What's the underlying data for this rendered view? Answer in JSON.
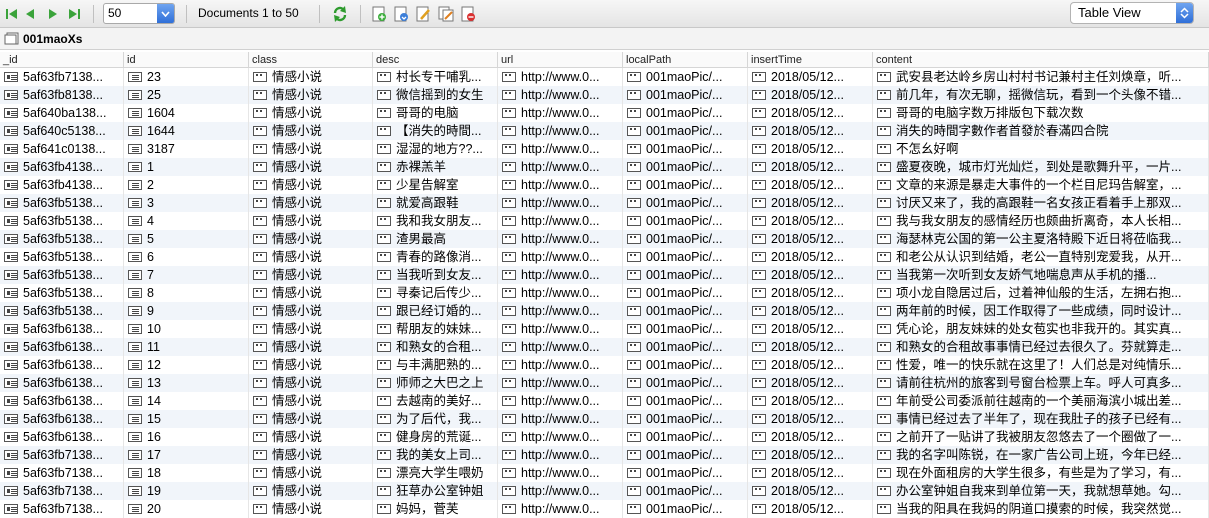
{
  "toolbar": {
    "page_size": "50",
    "doc_info": "Documents 1 to 50",
    "view_mode": "Table View"
  },
  "collection": {
    "name": "001maoXs"
  },
  "columns": [
    "_id",
    "id",
    "class",
    "desc",
    "url",
    "localPath",
    "insertTime",
    "content"
  ],
  "rows": [
    {
      "_id": "5af63fb7138...",
      "id": "23",
      "class": "情感小说",
      "desc": "村长专干哺乳...",
      "url": "http://www.0...",
      "localPath": "001maoPic/...",
      "insertTime": "2018/05/12...",
      "content": "武安县老达岭乡房山村村书记兼村主任刘焕章，听..."
    },
    {
      "_id": "5af63fb8138...",
      "id": "25",
      "class": "情感小说",
      "desc": "微信摇到的女生",
      "url": "http://www.0...",
      "localPath": "001maoPic/...",
      "insertTime": "2018/05/12...",
      "content": "前几年，有次无聊，摇微信玩，看到一个头像不错..."
    },
    {
      "_id": "5af640ba138...",
      "id": "1604",
      "class": "情感小说",
      "desc": "哥哥的电脑",
      "url": "http://www.0...",
      "localPath": "001maoPic/...",
      "insertTime": "2018/05/12...",
      "content": "哥哥的电脑字数万排版包下载次数"
    },
    {
      "_id": "5af640c5138...",
      "id": "1644",
      "class": "情感小说",
      "desc": "【消失的時間...",
      "url": "http://www.0...",
      "localPath": "001maoPic/...",
      "insertTime": "2018/05/12...",
      "content": "消失的時間字數作者首發於春滿四合院"
    },
    {
      "_id": "5af641c0138...",
      "id": "3187",
      "class": "情感小说",
      "desc": "湿湿的地方??...",
      "url": "http://www.0...",
      "localPath": "001maoPic/...",
      "insertTime": "2018/05/12...",
      "content": "不怎幺好啊"
    },
    {
      "_id": "5af63fb4138...",
      "id": "1",
      "class": "情感小说",
      "desc": "赤裸羔羊",
      "url": "http://www.0...",
      "localPath": "001maoPic/...",
      "insertTime": "2018/05/12...",
      "content": "盛夏夜晚，城市灯光灿烂，到处是歌舞升平，一片..."
    },
    {
      "_id": "5af63fb4138...",
      "id": "2",
      "class": "情感小说",
      "desc": "少星告解室",
      "url": "http://www.0...",
      "localPath": "001maoPic/...",
      "insertTime": "2018/05/12...",
      "content": "文章的来源是暴走大事件的一个栏目尼玛告解室，..."
    },
    {
      "_id": "5af63fb5138...",
      "id": "3",
      "class": "情感小说",
      "desc": "就爱高跟鞋",
      "url": "http://www.0...",
      "localPath": "001maoPic/...",
      "insertTime": "2018/05/12...",
      "content": "讨厌又来了，我的高跟鞋一名女孩正看着手上那双..."
    },
    {
      "_id": "5af63fb5138...",
      "id": "4",
      "class": "情感小说",
      "desc": "我和我女朋友...",
      "url": "http://www.0...",
      "localPath": "001maoPic/...",
      "insertTime": "2018/05/12...",
      "content": "我与我女朋友的感情经历也颇曲折离奇，本人长相..."
    },
    {
      "_id": "5af63fb5138...",
      "id": "5",
      "class": "情感小说",
      "desc": "渣男最高",
      "url": "http://www.0...",
      "localPath": "001maoPic/...",
      "insertTime": "2018/05/12...",
      "content": "海瑟林克公国的第一公主夏洛特殿下近日将莅临我..."
    },
    {
      "_id": "5af63fb5138...",
      "id": "6",
      "class": "情感小说",
      "desc": "青春的路像消...",
      "url": "http://www.0...",
      "localPath": "001maoPic/...",
      "insertTime": "2018/05/12...",
      "content": "和老公从认识到结婚，老公一直特别宠爱我，从开..."
    },
    {
      "_id": "5af63fb5138...",
      "id": "7",
      "class": "情感小说",
      "desc": "当我听到女友...",
      "url": "http://www.0...",
      "localPath": "001maoPic/...",
      "insertTime": "2018/05/12...",
      "content": "当我第一次听到女友娇气地喘息声从手机的播..."
    },
    {
      "_id": "5af63fb5138...",
      "id": "8",
      "class": "情感小说",
      "desc": "寻秦记后传少...",
      "url": "http://www.0...",
      "localPath": "001maoPic/...",
      "insertTime": "2018/05/12...",
      "content": "项小龙自隐居过后，过着神仙般的生活，左拥右抱..."
    },
    {
      "_id": "5af63fb5138...",
      "id": "9",
      "class": "情感小说",
      "desc": "跟已经订婚的...",
      "url": "http://www.0...",
      "localPath": "001maoPic/...",
      "insertTime": "2018/05/12...",
      "content": "两年前的时候，因工作取得了一些成绩，同时设计..."
    },
    {
      "_id": "5af63fb6138...",
      "id": "10",
      "class": "情感小说",
      "desc": "帮朋友的妹妹...",
      "url": "http://www.0...",
      "localPath": "001maoPic/...",
      "insertTime": "2018/05/12...",
      "content": "凭心论，朋友妹妹的处女苞实也非我开的。其实真..."
    },
    {
      "_id": "5af63fb6138...",
      "id": "11",
      "class": "情感小说",
      "desc": "和熟女的合租...",
      "url": "http://www.0...",
      "localPath": "001maoPic/...",
      "insertTime": "2018/05/12...",
      "content": "和熟女的合租故事事情已经过去很久了。芬就算走..."
    },
    {
      "_id": "5af63fb6138...",
      "id": "12",
      "class": "情感小说",
      "desc": "与丰满肥熟的...",
      "url": "http://www.0...",
      "localPath": "001maoPic/...",
      "insertTime": "2018/05/12...",
      "content": "性爱，唯一的快乐就在这里了！人们总是对纯情乐..."
    },
    {
      "_id": "5af63fb6138...",
      "id": "13",
      "class": "情感小说",
      "desc": "师师之大巴之上",
      "url": "http://www.0...",
      "localPath": "001maoPic/...",
      "insertTime": "2018/05/12...",
      "content": "请前往杭州的旅客到号窗台检票上车。呼人可真多..."
    },
    {
      "_id": "5af63fb6138...",
      "id": "14",
      "class": "情感小说",
      "desc": "去越南的美好...",
      "url": "http://www.0...",
      "localPath": "001maoPic/...",
      "insertTime": "2018/05/12...",
      "content": "年前受公司委派前往越南的一个美丽海滨小城出差..."
    },
    {
      "_id": "5af63fb6138...",
      "id": "15",
      "class": "情感小说",
      "desc": "为了后代，我...",
      "url": "http://www.0...",
      "localPath": "001maoPic/...",
      "insertTime": "2018/05/12...",
      "content": "事情已经过去了半年了，现在我肚子的孩子已经有..."
    },
    {
      "_id": "5af63fb6138...",
      "id": "16",
      "class": "情感小说",
      "desc": "健身房的荒诞...",
      "url": "http://www.0...",
      "localPath": "001maoPic/...",
      "insertTime": "2018/05/12...",
      "content": "之前开了一贴讲了我被朋友忽悠去了一个圈做了一..."
    },
    {
      "_id": "5af63fb7138...",
      "id": "17",
      "class": "情感小说",
      "desc": "我的美女上司...",
      "url": "http://www.0...",
      "localPath": "001maoPic/...",
      "insertTime": "2018/05/12...",
      "content": "我的名字叫陈锐，在一家广告公司上班，今年已经..."
    },
    {
      "_id": "5af63fb7138...",
      "id": "18",
      "class": "情感小说",
      "desc": "漂亮大学生喂奶",
      "url": "http://www.0...",
      "localPath": "001maoPic/...",
      "insertTime": "2018/05/12...",
      "content": "现在外面租房的大学生很多，有些是为了学习，有..."
    },
    {
      "_id": "5af63fb7138...",
      "id": "19",
      "class": "情感小说",
      "desc": "狂草办公室钟姐",
      "url": "http://www.0...",
      "localPath": "001maoPic/...",
      "insertTime": "2018/05/12...",
      "content": "办公室钟姐自我来到单位第一天，我就想草她。勾..."
    },
    {
      "_id": "5af63fb7138...",
      "id": "20",
      "class": "情感小说",
      "desc": "妈妈，菅芙",
      "url": "http://www.0...",
      "localPath": "001maoPic/...",
      "insertTime": "2018/05/12...",
      "content": "当我的阳具在我妈的阴道口摸索的时候，我突然觉..."
    }
  ]
}
